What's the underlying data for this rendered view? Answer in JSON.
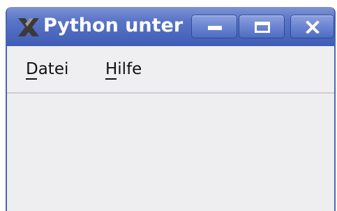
{
  "window": {
    "title": "Python unter",
    "app_icon": "x-logo-icon",
    "controls": {
      "minimize": "minimize-icon",
      "maximize": "maximize-icon",
      "close": "close-icon"
    }
  },
  "menubar": {
    "items": [
      {
        "label": "Datei",
        "mnemonic": "D"
      },
      {
        "label": "Hilfe",
        "mnemonic": "H"
      }
    ]
  },
  "colors": {
    "titlebar": "#4f6cc2",
    "window_bg": "#eeedf0",
    "title_text": "#ffffff"
  }
}
